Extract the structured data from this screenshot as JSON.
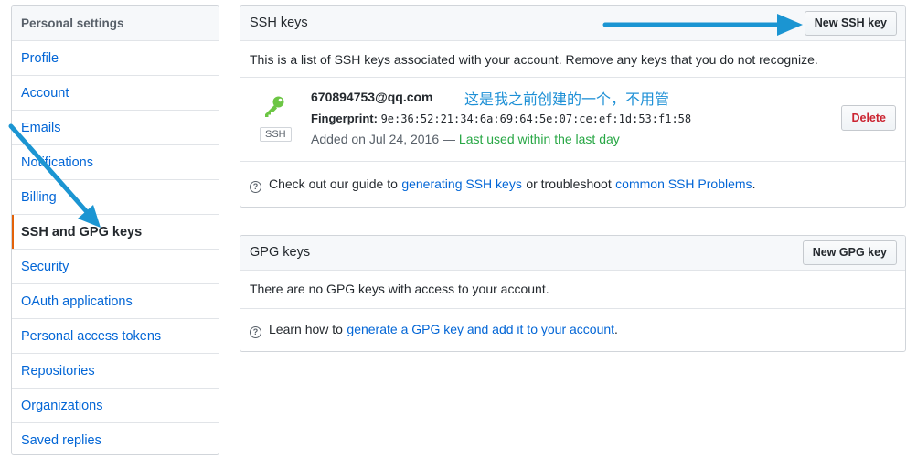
{
  "sidebar": {
    "heading": "Personal settings",
    "items": [
      {
        "label": "Profile"
      },
      {
        "label": "Account"
      },
      {
        "label": "Emails"
      },
      {
        "label": "Notifications"
      },
      {
        "label": "Billing"
      },
      {
        "label": "SSH and GPG keys",
        "selected": true
      },
      {
        "label": "Security"
      },
      {
        "label": "OAuth applications"
      },
      {
        "label": "Personal access tokens"
      },
      {
        "label": "Repositories"
      },
      {
        "label": "Organizations"
      },
      {
        "label": "Saved replies"
      }
    ]
  },
  "ssh": {
    "title": "SSH keys",
    "new_button": "New SSH key",
    "description": "This is a list of SSH keys associated with your account. Remove any keys that you do not recognize.",
    "key": {
      "icon": "key-icon",
      "type_badge": "SSH",
      "email": "670894753@qq.com",
      "annotation": "这是我之前创建的一个，不用管",
      "fingerprint_label": "Fingerprint:",
      "fingerprint": "9e:36:52:21:34:6a:69:64:5e:07:ce:ef:1d:53:f1:58",
      "added": "Added on Jul 24, 2016 —",
      "last_used": "Last used within the last day",
      "delete_button": "Delete"
    },
    "guide": {
      "prefix": "Check out our guide to",
      "link1": "generating SSH keys",
      "middle": "or troubleshoot",
      "link2": "common SSH Problems",
      "suffix": "."
    }
  },
  "gpg": {
    "title": "GPG keys",
    "new_button": "New GPG key",
    "empty": "There are no GPG keys with access to your account.",
    "guide": {
      "prefix": "Learn how to",
      "link": "generate a GPG key and add it to your account",
      "suffix": "."
    }
  },
  "colors": {
    "link": "#0366d6",
    "selected_bar": "#e36209",
    "key_icon": "#6cc644",
    "last_used": "#28a745",
    "delete": "#cb2431",
    "annotation": "#1e90d6",
    "arrow": "#1b95d2"
  }
}
